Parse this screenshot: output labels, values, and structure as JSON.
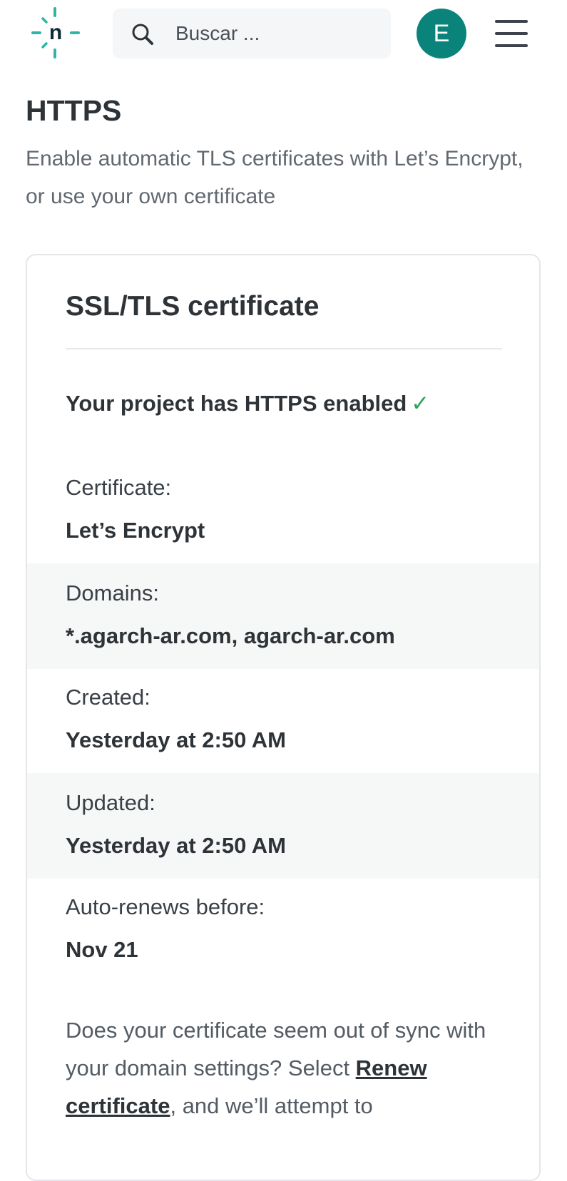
{
  "header": {
    "logo_letter": "n",
    "search": {
      "placeholder": "Buscar ..."
    },
    "avatar_initial": "E",
    "accent_color": "#0a847a"
  },
  "page": {
    "title": "HTTPS",
    "description": "Enable automatic TLS certificates with Let’s Encrypt, or use your own certificate"
  },
  "card": {
    "title": "SSL/TLS certificate",
    "status": "Your project has HTTPS enabled",
    "status_icon": "✓",
    "details": [
      {
        "label": "Certificate:",
        "value": "Let’s Encrypt"
      },
      {
        "label": "Domains:",
        "value": "*.agarch-ar.com, agarch-ar.com"
      },
      {
        "label": "Created:",
        "value": "Yesterday at 2:50 AM"
      },
      {
        "label": "Updated:",
        "value": "Yesterday at 2:50 AM"
      },
      {
        "label": "Auto-renews before:",
        "value": "Nov 21"
      }
    ],
    "sync_text_before": "Does your certificate seem out of sync with your domain settings? Select ",
    "sync_link": "Renew certificate",
    "sync_text_after": ", and we’ll attempt to"
  }
}
